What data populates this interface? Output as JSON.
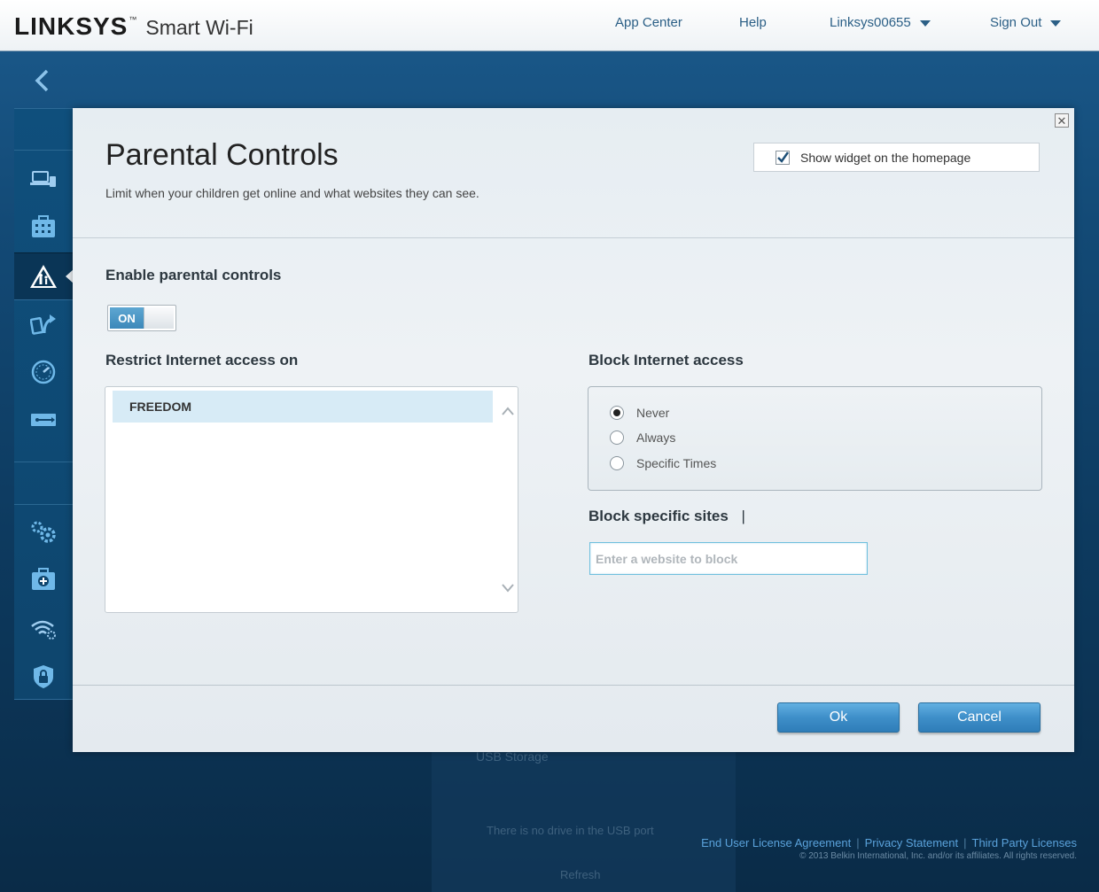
{
  "header": {
    "brand": "LINKSYS",
    "trademark": "™",
    "product": "Smart Wi-Fi",
    "nav": {
      "app_center": "App Center",
      "help": "Help",
      "router_name": "Linksys00655",
      "sign_out": "Sign Out"
    }
  },
  "sidebar": {
    "icons": [
      "back-arrow-icon",
      "devices-icon",
      "toolbox-icon",
      "parental-controls-icon",
      "media-prioritization-icon",
      "speed-test-icon",
      "usb-storage-icon",
      "settings-gears-icon",
      "troubleshooting-icon",
      "wireless-icon",
      "security-shield-icon"
    ],
    "active": "parental-controls-icon"
  },
  "background": {
    "widget_title": "USB Storage",
    "empty_text": "There is no drive in the USB port",
    "refresh": "Refresh"
  },
  "footer": {
    "links": [
      "End User License Agreement",
      "Privacy Statement",
      "Third Party Licenses"
    ],
    "copyright": "© 2013 Belkin International, Inc. and/or its affiliates. All rights reserved."
  },
  "modal": {
    "close": "✕",
    "title": "Parental Controls",
    "subtitle": "Limit when your children get online and what websites they can see.",
    "show_widget_label": "Show widget on the homepage",
    "show_widget_checked": true,
    "enable_label": "Enable parental controls",
    "toggle_state": "ON",
    "restrict_label": "Restrict Internet access on",
    "devices": [
      "FREEDOM"
    ],
    "block_access_label": "Block Internet access",
    "block_options": [
      "Never",
      "Always",
      "Specific Times"
    ],
    "block_selected": "Never",
    "block_sites_label": "Block specific sites",
    "block_sites_placeholder": "Enter a website to block",
    "ok_label": "Ok",
    "cancel_label": "Cancel"
  },
  "colors": {
    "accent": "#3e8fc9",
    "link": "#5aa2db",
    "selected_row": "#d7ebf6"
  }
}
